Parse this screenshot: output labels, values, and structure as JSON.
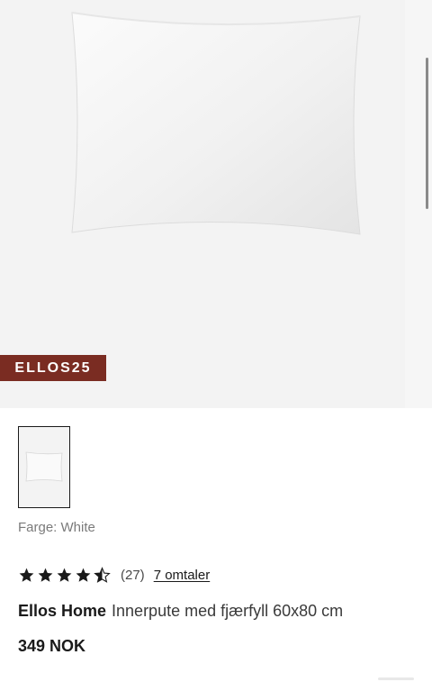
{
  "hero": {
    "image": "pillow-image",
    "promo_badge": "ELLOS25"
  },
  "thumbnails": [
    {
      "image": "pillow-thumbnail",
      "selected": true
    }
  ],
  "product": {
    "color_label": "Farge: White",
    "rating": 4.5,
    "rating_max": 5,
    "rating_count": "(27)",
    "reviews_link": "7 omtaler",
    "brand": "Ellos Home",
    "name": "Innerpute med fjærfyll 60x80 cm",
    "price": "349 NOK"
  },
  "colors": {
    "badge_bg": "#7a2c22",
    "image_bg": "#f3f3f3",
    "star": "#1a1a1a"
  }
}
